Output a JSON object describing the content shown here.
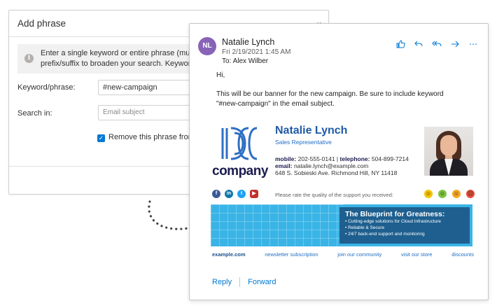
{
  "panel": {
    "title": "Add phrase",
    "chevron": "⌄",
    "info_line1": "Enter a single keyword or entire phrase (multip",
    "info_line2": "prefix/suffix to broaden your search. Keywords/",
    "keyword_label": "Keyword/phrase:",
    "keyword_value": "#new-campaign",
    "search_in_label": "Search in:",
    "search_in_placeholder": "Email subject",
    "checkbox_label": "Remove this phrase from"
  },
  "email": {
    "avatar_initials": "NL",
    "sender": "Natalie Lynch",
    "date": "Fri 2/19/2021 1:45 AM",
    "to": "To: Alex Wilber",
    "greeting": "Hi,",
    "body_line1": "This will be our banner for the new campaign. Be sure to include keyword",
    "body_line2": "\"#new-campaign\" in the email subject.",
    "actions": [
      "like-icon",
      "reply-icon",
      "reply-all-icon",
      "forward-icon",
      "more-icon"
    ],
    "reply": "Reply",
    "forward": "Forward"
  },
  "signature": {
    "logo_text": "company",
    "name": "Natalie Lynch",
    "title": "Sales Representative",
    "mobile_label": "mobile:",
    "mobile": "202-555-0141",
    "separator": "|",
    "telephone_label": "telephone:",
    "telephone": "504-899-7214",
    "email_label": "email:",
    "email": "natalie.lynch@example.com",
    "address": "648 S. Sobieski Ave. Richmond Hill, NY 11418",
    "rate_text": "Please rate the quality of the support you received:",
    "social": [
      {
        "icon": "facebook-icon",
        "glyph": "f",
        "color": "#3b5998"
      },
      {
        "icon": "linkedin-icon",
        "glyph": "in",
        "color": "#0e76a8"
      },
      {
        "icon": "twitter-icon",
        "glyph": "t",
        "color": "#1da1f2"
      },
      {
        "icon": "youtube-icon",
        "glyph": "▶",
        "color": "#c4302b"
      }
    ],
    "smileys": [
      {
        "icon": "very-happy-smiley-icon",
        "color": "#f5c400"
      },
      {
        "icon": "happy-smiley-icon",
        "color": "#7cc242"
      },
      {
        "icon": "neutral-smiley-icon",
        "color": "#f5a623"
      },
      {
        "icon": "sad-smiley-icon",
        "color": "#e74c3c"
      }
    ],
    "banner_title": "The Blueprint for Greatness:",
    "banner_bullets": [
      "• Cutting-edge solutions for Cloud Infrastructure",
      "• Reliable & Secure",
      "• 24/7 back-end support and monitoring"
    ],
    "links": [
      "example.com",
      "newsletter subscription",
      "join our community",
      "visit our store",
      "discounts"
    ]
  }
}
